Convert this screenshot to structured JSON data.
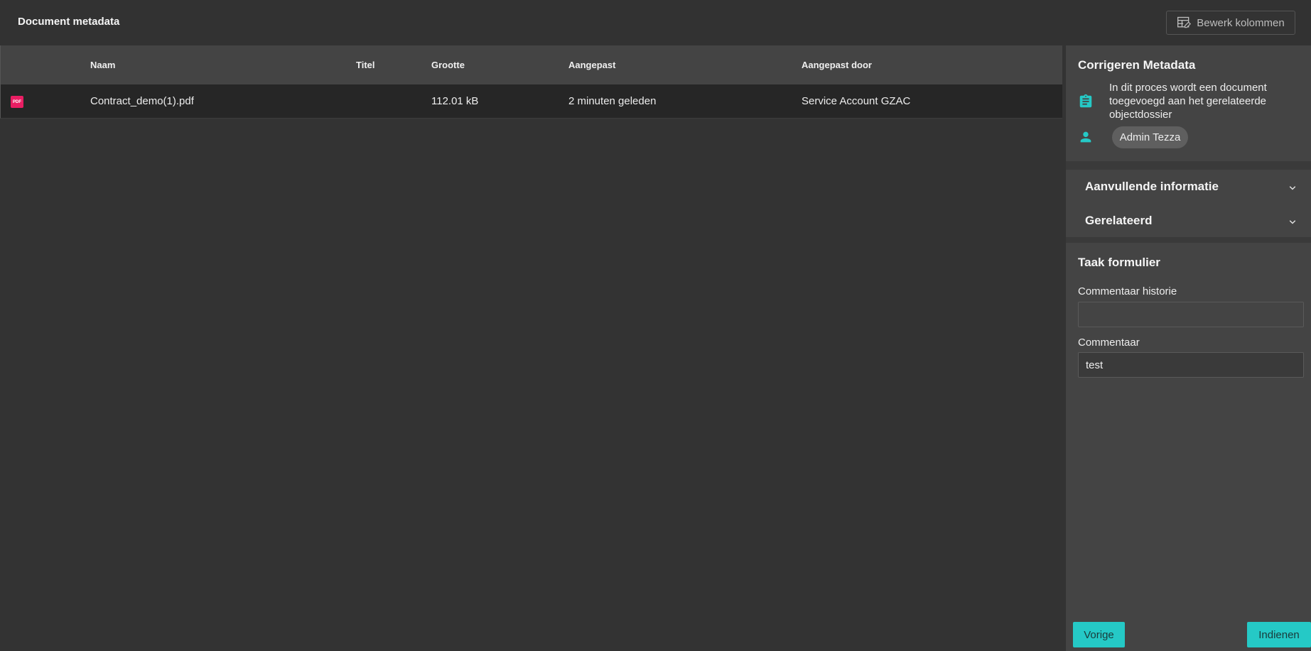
{
  "header": {
    "title": "Document metadata",
    "edit_columns_label": "Bewerk kolommen"
  },
  "table": {
    "columns": [
      "Naam",
      "Titel",
      "Grootte",
      "Aangepast",
      "Aangepast door"
    ],
    "rows": [
      {
        "file_type_icon": "PDF",
        "naam": "Contract_demo(1).pdf",
        "titel": "",
        "grootte": "112.01 kB",
        "aangepast": "2 minuten geleden",
        "aangepast_door": "Service Account GZAC"
      }
    ]
  },
  "task_card": {
    "title": "Corrigeren Metadata",
    "description": "In dit proces wordt een document toegevoegd aan het gerelateerde objectdossier",
    "assignee": "Admin Tezza"
  },
  "accordion": {
    "items": [
      {
        "label": "Aanvullende informatie"
      },
      {
        "label": "Gerelateerd"
      }
    ]
  },
  "form": {
    "title": "Taak formulier",
    "fields": [
      {
        "label": "Commentaar historie",
        "value": ""
      },
      {
        "label": "Commentaar",
        "value": "test"
      }
    ],
    "prev_label": "Vorige",
    "submit_label": "Indienen"
  },
  "colors": {
    "accent": "#25c9c6",
    "pdf_badge": "#e91e63",
    "background": "#333333",
    "panel": "#444444"
  },
  "icons": [
    "edit-columns-icon",
    "pdf-file-icon",
    "clipboard-icon",
    "person-icon",
    "chevron-down-icon"
  ]
}
